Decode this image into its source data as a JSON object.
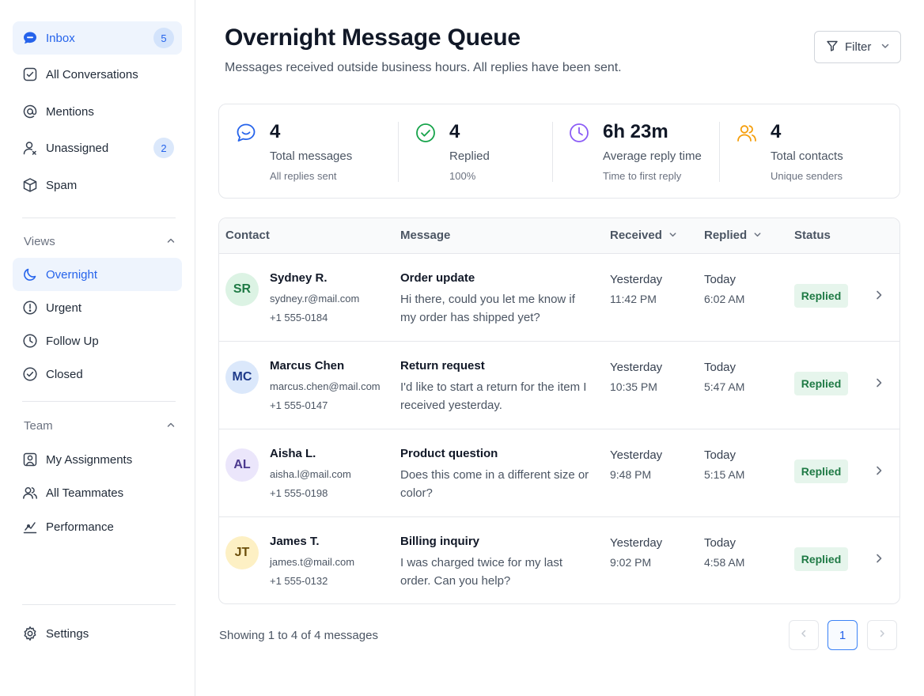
{
  "sidebar": {
    "inbox": {
      "label": "Inbox",
      "count": "5",
      "icon": "chat-bubble-icon"
    },
    "all_conversations": {
      "label": "All Conversations",
      "icon": "conversation-icon"
    },
    "mentions": {
      "label": "Mentions",
      "icon": "at-sign-icon"
    },
    "unassigned": {
      "label": "Unassigned",
      "count": "2",
      "icon": "user-icon"
    },
    "spam": {
      "label": "Spam",
      "icon": "box-icon"
    },
    "views_title": "Views",
    "views": [
      {
        "label": "Overnight",
        "icon": "moon-icon"
      },
      {
        "label": "Urgent",
        "icon": "alert-circle-icon"
      },
      {
        "label": "Follow Up",
        "icon": "clock-icon"
      },
      {
        "label": "Closed",
        "icon": "check-circle-icon"
      }
    ],
    "team_title": "Team",
    "team": [
      {
        "label": "My Assignments",
        "icon": "user-square-icon"
      },
      {
        "label": "All Teammates",
        "icon": "users-icon"
      },
      {
        "label": "Performance",
        "icon": "trend-icon"
      }
    ],
    "settings": {
      "label": "Settings",
      "icon": "gear-icon"
    }
  },
  "header": {
    "title": "Overnight Message Queue",
    "subtitle": "Messages received outside business hours. All replies have been sent.",
    "filter_label": "Filter"
  },
  "stats": [
    {
      "value": "4",
      "label": "Total messages",
      "note": "All replies sent",
      "icon": "message-icon",
      "color": "#2563eb"
    },
    {
      "value": "4",
      "label": "Replied",
      "note": "100%",
      "icon": "check-circle-icon",
      "color": "#16a34a"
    },
    {
      "value": "6h 23m",
      "label": "Average reply time",
      "note": "Time to first reply",
      "icon": "clock-icon",
      "color": "#8b5cf6"
    },
    {
      "value": "4",
      "label": "Total contacts",
      "note": "Unique senders",
      "icon": "users-icon",
      "color": "#f59e0b"
    }
  ],
  "table": {
    "headers": {
      "contact": "Contact",
      "message": "Message",
      "received": "Received",
      "replied": "Replied",
      "status": "Status"
    },
    "rows": [
      {
        "initials": "SR",
        "avatar_bg": "#dcf3e4",
        "avatar_fg": "#1f7a45",
        "name": "Sydney R.",
        "email": "sydney.r@mail.com",
        "phone": "+1 555-0184",
        "subject": "Order update",
        "body": "Hi there, could you let me know if my order has shipped yet?",
        "received_day": "Yesterday",
        "received_time": "11:42 PM",
        "replied_day": "Today",
        "replied_time": "6:02 AM",
        "status": "Replied"
      },
      {
        "initials": "MC",
        "avatar_bg": "#dbe8fb",
        "avatar_fg": "#1e3a8a",
        "name": "Marcus Chen",
        "email": "marcus.chen@mail.com",
        "phone": "+1 555-0147",
        "subject": "Return request",
        "body": "I'd like to start a return for the item I received yesterday.",
        "received_day": "Yesterday",
        "received_time": "10:35 PM",
        "replied_day": "Today",
        "replied_time": "5:47 AM",
        "status": "Replied"
      },
      {
        "initials": "AL",
        "avatar_bg": "#ebe6fb",
        "avatar_fg": "#4c3a8f",
        "name": "Aisha L.",
        "email": "aisha.l@mail.com",
        "phone": "+1 555-0198",
        "subject": "Product question",
        "body": "Does this come in a different size or color?",
        "received_day": "Yesterday",
        "received_time": "9:48 PM",
        "replied_day": "Today",
        "replied_time": "5:15 AM",
        "status": "Replied"
      },
      {
        "initials": "JT",
        "avatar_bg": "#fdf0c4",
        "avatar_fg": "#6b4e0a",
        "name": "James T.",
        "email": "james.t@mail.com",
        "phone": "+1 555-0132",
        "subject": "Billing inquiry",
        "body": "I was charged twice for my last order. Can you help?",
        "received_day": "Yesterday",
        "received_time": "9:02 PM",
        "replied_day": "Today",
        "replied_time": "4:58 AM",
        "status": "Replied"
      }
    ]
  },
  "footer": {
    "showing": "Showing 1 to 4 of 4 messages",
    "current_page": "1"
  }
}
